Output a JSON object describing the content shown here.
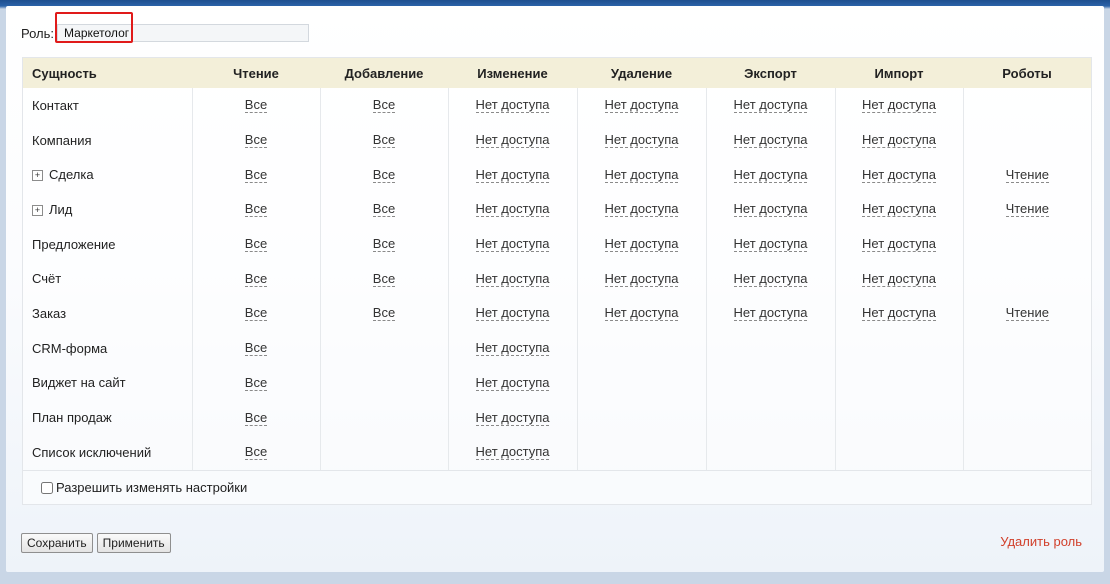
{
  "role": {
    "label": "Роль:",
    "value": "Маркетолог"
  },
  "columns": [
    "Сущность",
    "Чтение",
    "Добавление",
    "Изменение",
    "Удаление",
    "Экспорт",
    "Импорт",
    "Роботы"
  ],
  "rows": [
    {
      "entity": "Контакт",
      "expandable": false,
      "cells": [
        "Все",
        "Все",
        "Нет доступа",
        "Нет доступа",
        "Нет доступа",
        "Нет доступа",
        ""
      ]
    },
    {
      "entity": "Компания",
      "expandable": false,
      "cells": [
        "Все",
        "Все",
        "Нет доступа",
        "Нет доступа",
        "Нет доступа",
        "Нет доступа",
        ""
      ]
    },
    {
      "entity": "Сделка",
      "expandable": true,
      "cells": [
        "Все",
        "Все",
        "Нет доступа",
        "Нет доступа",
        "Нет доступа",
        "Нет доступа",
        "Чтение"
      ]
    },
    {
      "entity": "Лид",
      "expandable": true,
      "cells": [
        "Все",
        "Все",
        "Нет доступа",
        "Нет доступа",
        "Нет доступа",
        "Нет доступа",
        "Чтение"
      ]
    },
    {
      "entity": "Предложение",
      "expandable": false,
      "cells": [
        "Все",
        "Все",
        "Нет доступа",
        "Нет доступа",
        "Нет доступа",
        "Нет доступа",
        ""
      ]
    },
    {
      "entity": "Счёт",
      "expandable": false,
      "cells": [
        "Все",
        "Все",
        "Нет доступа",
        "Нет доступа",
        "Нет доступа",
        "Нет доступа",
        ""
      ]
    },
    {
      "entity": "Заказ",
      "expandable": false,
      "cells": [
        "Все",
        "Все",
        "Нет доступа",
        "Нет доступа",
        "Нет доступа",
        "Нет доступа",
        "Чтение"
      ]
    },
    {
      "entity": "CRM-форма",
      "expandable": false,
      "cells": [
        "Все",
        "",
        "Нет доступа",
        "",
        "",
        "",
        ""
      ]
    },
    {
      "entity": "Виджет на сайт",
      "expandable": false,
      "cells": [
        "Все",
        "",
        "Нет доступа",
        "",
        "",
        "",
        ""
      ]
    },
    {
      "entity": "План продаж",
      "expandable": false,
      "cells": [
        "Все",
        "",
        "Нет доступа",
        "",
        "",
        "",
        ""
      ]
    },
    {
      "entity": "Список исключений",
      "expandable": false,
      "cells": [
        "Все",
        "",
        "Нет доступа",
        "",
        "",
        "",
        ""
      ]
    }
  ],
  "allow_settings": {
    "label": "Разрешить изменять настройки",
    "checked": false
  },
  "buttons": {
    "save": "Сохранить",
    "apply": "Применить"
  },
  "delete_role": "Удалить роль",
  "expand_glyph": "+"
}
